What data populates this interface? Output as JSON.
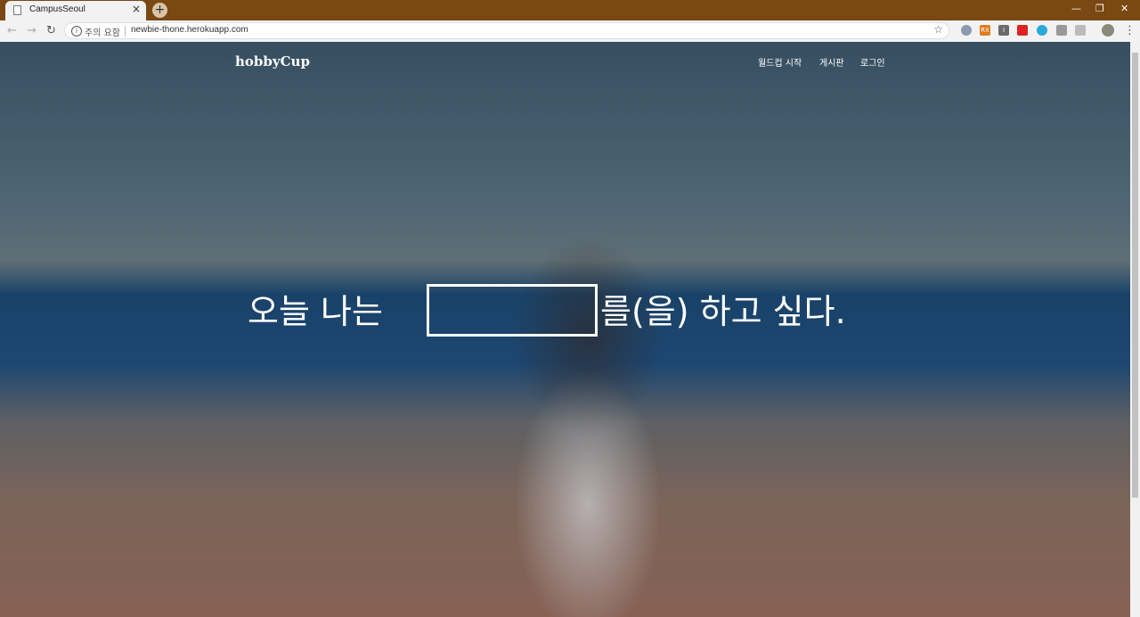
{
  "browser": {
    "tab_title": "CampusSeoul",
    "tab_close": "×",
    "new_tab": "+",
    "security_label": "주의 요함",
    "url": "newbie-thone.herokuapp.com"
  },
  "site": {
    "brand": "hobbyCup",
    "nav": [
      "월드컵 시작",
      "게시판",
      "로그인"
    ]
  },
  "hero": {
    "text_before": "오늘 나는",
    "input_value": "",
    "text_after": "를(을) 하고 싶다."
  },
  "colors": {
    "titlebar": "#7a4812",
    "accent_white": "#ffffff"
  }
}
